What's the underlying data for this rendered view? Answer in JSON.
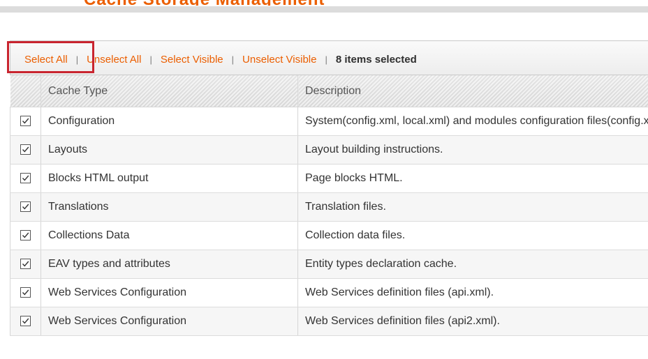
{
  "header": {
    "title": "Cache Storage Management"
  },
  "massaction": {
    "select_all": "Select All",
    "unselect_all": "Unselect All",
    "select_visible": "Select Visible",
    "unselect_visible": "Unselect Visible",
    "separator": "|",
    "selected_count": "8",
    "selected_suffix": " items selected"
  },
  "grid": {
    "headers": [
      "",
      "Cache Type",
      "Description"
    ],
    "rows": [
      {
        "checked": true,
        "type": "Configuration",
        "description": "System(config.xml, local.xml) and modules configuration files(config.xml)."
      },
      {
        "checked": true,
        "type": "Layouts",
        "description": "Layout building instructions."
      },
      {
        "checked": true,
        "type": "Blocks HTML output",
        "description": "Page blocks HTML."
      },
      {
        "checked": true,
        "type": "Translations",
        "description": "Translation files."
      },
      {
        "checked": true,
        "type": "Collections Data",
        "description": "Collection data files."
      },
      {
        "checked": true,
        "type": "EAV types and attributes",
        "description": "Entity types declaration cache."
      },
      {
        "checked": true,
        "type": "Web Services Configuration",
        "description": "Web Services definition files (api.xml)."
      },
      {
        "checked": true,
        "type": "Web Services Configuration",
        "description": "Web Services definition files (api2.xml)."
      }
    ]
  },
  "colors": {
    "link": "#eb5e00",
    "highlight": "#c9252f"
  }
}
